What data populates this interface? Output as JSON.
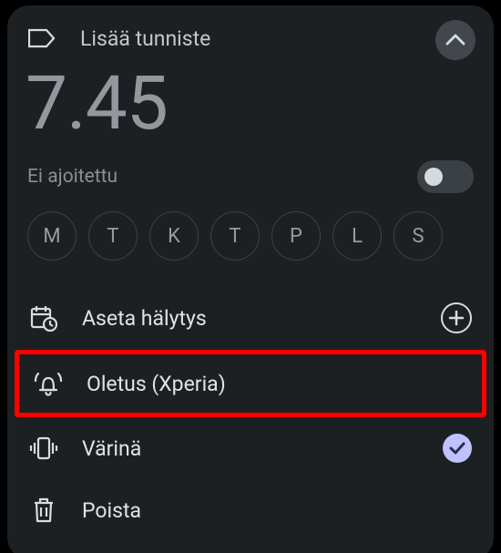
{
  "label": {
    "placeholder": "Lisää tunniste"
  },
  "time": "7.45",
  "schedule": {
    "text": "Ei ajoitettu",
    "enabled": false
  },
  "days": [
    "M",
    "T",
    "K",
    "T",
    "P",
    "L",
    "S"
  ],
  "options": {
    "schedule_alarm": "Aseta hälytys",
    "ringtone": "Oletus (Xperia)",
    "vibrate": "Värinä",
    "delete": "Poista"
  }
}
